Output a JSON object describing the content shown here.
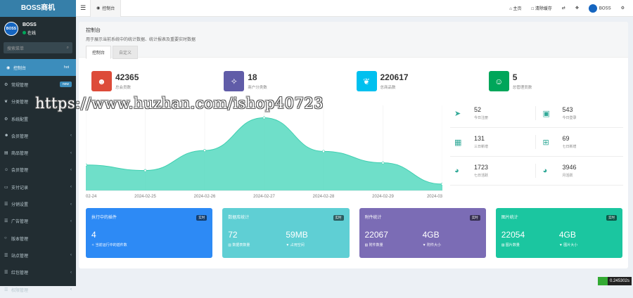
{
  "brand": "BOSS商机",
  "user": {
    "name": "BOSS",
    "status": "在线",
    "avatar_text": "BOSS"
  },
  "search": {
    "placeholder": "搜索菜单"
  },
  "menu": [
    {
      "label": "控制台",
      "icon": "dashboard-icon",
      "badge": "hot",
      "badge_color": "#3c8dbc",
      "active": true
    },
    {
      "label": "常规管理",
      "icon": "cogs-icon",
      "badge": "new",
      "badge_color": "#3c8dbc"
    },
    {
      "label": "分类管理",
      "icon": "leaf-icon"
    },
    {
      "label": "系统配置",
      "icon": "gear-icon"
    },
    {
      "label": "会员管理",
      "icon": "users-icon",
      "chev": true
    },
    {
      "label": "商品管理",
      "icon": "shop-icon",
      "chev": true
    },
    {
      "label": "会员管理",
      "icon": "user-icon",
      "chev": true
    },
    {
      "label": "支付记录",
      "icon": "card-icon",
      "chev": true
    },
    {
      "label": "分销设置",
      "icon": "list-icon",
      "chev": true
    },
    {
      "label": "广告管理",
      "icon": "list-icon",
      "chev": true
    },
    {
      "label": "版本管理",
      "icon": "circle-icon"
    },
    {
      "label": "站点管理",
      "icon": "list-icon",
      "chev": true
    },
    {
      "label": "红包管理",
      "icon": "list-icon",
      "chev": true
    },
    {
      "label": "权限管理",
      "icon": "list-icon",
      "chev": true
    }
  ],
  "topbar": {
    "tab": "控制台",
    "home": "主页",
    "clear": "清除缓存",
    "user": "BOSS"
  },
  "page": {
    "title": "控制台",
    "subtitle": "用于展示当前系统中的统计数据、统计报表及重要实时数据",
    "tabs": [
      "控制台",
      "自定义"
    ]
  },
  "stats": [
    {
      "value": "42365",
      "label": "总会员数",
      "color": "#dd4b39",
      "icon": "users-icon"
    },
    {
      "value": "18",
      "label": "商户分类数",
      "color": "#605ca8",
      "icon": "magic-icon"
    },
    {
      "value": "220617",
      "label": "总商品数",
      "color": "#00c0ef",
      "icon": "leaf-icon"
    },
    {
      "value": "5",
      "label": "总管理员数",
      "color": "#00a65a",
      "icon": "user-icon"
    }
  ],
  "mini": [
    [
      {
        "value": "52",
        "label": "今日注册",
        "icon": "rocket-icon"
      },
      {
        "value": "543",
        "label": "今日登录",
        "icon": "vcard-icon"
      }
    ],
    [
      {
        "value": "131",
        "label": "三日新增",
        "icon": "calendar-icon"
      },
      {
        "value": "69",
        "label": "七日新增",
        "icon": "calendar-plus-icon"
      }
    ],
    [
      {
        "value": "1723",
        "label": "七日活跃",
        "icon": "user-circle-icon"
      },
      {
        "value": "3946",
        "label": "月活跃",
        "icon": "user-circle-icon"
      }
    ]
  ],
  "chart_data": {
    "type": "area",
    "x": [
      "02-24",
      "2024-02-25",
      "2024-02-26",
      "2024-02-27",
      "2024-02-28",
      "2024-02-29",
      "2024-03"
    ],
    "series": [
      {
        "values": [
          300,
          235,
          470,
          855,
          460,
          325,
          75
        ]
      }
    ],
    "ylim": [
      0,
      1000
    ],
    "color": "#5fdcc3"
  },
  "cards": [
    {
      "title": "执行中的插件",
      "tag": "实时",
      "color": "#2d8af5",
      "cols": [
        {
          "value": "4",
          "label": "当前运行中的插件数",
          "icon": "magic-icon"
        }
      ]
    },
    {
      "title": "数据库统计",
      "tag": "实时",
      "color": "#5fcfd4",
      "cols": [
        {
          "value": "72",
          "label": "数据表数量",
          "icon": "db-icon"
        },
        {
          "value": "59MB",
          "label": "占用空间",
          "icon": "filter-icon"
        }
      ]
    },
    {
      "title": "附件统计",
      "tag": "实时",
      "color": "#7b6cb5",
      "cols": [
        {
          "value": "22067",
          "label": "附件数量",
          "icon": "files-icon"
        },
        {
          "value": "4GB",
          "label": "附件大小",
          "icon": "filter-icon"
        }
      ]
    },
    {
      "title": "图片统计",
      "tag": "实时",
      "color": "#1bc6a0",
      "cols": [
        {
          "value": "22054",
          "label": "图片数量",
          "icon": "image-icon"
        },
        {
          "value": "4GB",
          "label": "图片大小",
          "icon": "filter-icon"
        }
      ]
    }
  ],
  "timer": "0.245302s",
  "watermark": "https://www.huzhan.com/ishop40723"
}
